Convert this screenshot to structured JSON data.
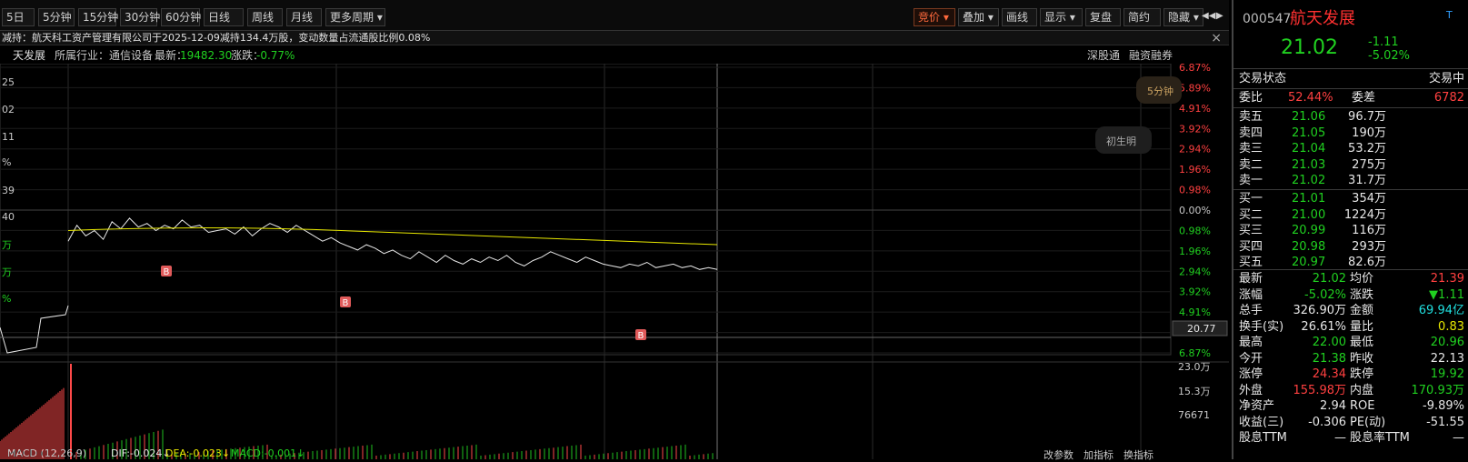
{
  "toolbar": {
    "left_buttons": [
      "5日",
      "5分钟",
      "15分钟",
      "30分钟",
      "60分钟",
      "日线",
      "周线",
      "月线",
      "更多周期"
    ],
    "right_buttons": [
      "竞价",
      "叠加",
      "画线",
      "显示",
      "复盘",
      "简约",
      "隐藏"
    ],
    "nav_icons": [
      "◀◀",
      "▶"
    ]
  },
  "notice": {
    "text": "减持：航天科工资产管理有限公司于2025-12-09减持134.4万股，变动数量占流通股比例0.08%",
    "close": "×"
  },
  "infobar": {
    "name": "天发展",
    "industry": "所属行业：通信设备",
    "latest": "最新：",
    "latest_value": "19482.30",
    "change": "涨跌：",
    "change_value": "-0.77%",
    "link1": "深股通",
    "link2": "融资融券"
  },
  "chart": {
    "right_axis_labels": [
      "6.87%",
      "5.89%",
      "4.91%",
      "3.92%",
      "2.94%",
      "1.96%",
      "0.98%",
      "0.00%",
      "0.98%",
      "1.96%",
      "2.94%",
      "3.92%",
      "4.91%",
      "5.89%",
      "6.87%"
    ],
    "left_axis_labels": [
      "25",
      "02",
      "11",
      "%",
      "39",
      "40",
      "万",
      "万",
      "%"
    ],
    "current_price_label": "20.77",
    "period_badge": "5分钟",
    "help_badge": "初生明",
    "b_label": "B",
    "volume_axis_labels": [
      "23.0万",
      "15.3万",
      "76671"
    ],
    "macd_label": "MACD (12,26,9)",
    "dif": "DIF:-0.024↓",
    "dea": "DEA:-0.023↓",
    "macd_value": "MACD:-0.001↓",
    "bottom_links": [
      "改参数",
      "加指标",
      "换指标"
    ]
  },
  "panel": {
    "code": "000547",
    "name": "航天发展",
    "badge": "T",
    "price": "21.02",
    "change": "-1.11",
    "change_pct": "-5.02%",
    "status_label": "交易状态",
    "status_value": "交易中",
    "ratio_label": "委比",
    "ratio_value": "52.44%",
    "diff_label": "委差",
    "diff_value": "6782",
    "sells": [
      {
        "label": "卖五",
        "price": "21.06",
        "vol": "96.7万"
      },
      {
        "label": "卖四",
        "price": "21.05",
        "vol": "190万"
      },
      {
        "label": "卖三",
        "price": "21.04",
        "vol": "53.2万"
      },
      {
        "label": "卖二",
        "price": "21.03",
        "vol": "275万"
      },
      {
        "label": "卖一",
        "price": "21.02",
        "vol": "31.7万"
      }
    ],
    "buys": [
      {
        "label": "买一",
        "price": "21.01",
        "vol": "354万"
      },
      {
        "label": "买二",
        "price": "21.00",
        "vol": "1224万"
      },
      {
        "label": "买三",
        "price": "20.99",
        "vol": "116万"
      },
      {
        "label": "买四",
        "price": "20.98",
        "vol": "293万"
      },
      {
        "label": "买五",
        "price": "20.97",
        "vol": "82.6万"
      }
    ],
    "stats": [
      {
        "l1": "最新",
        "v1": "21.02",
        "c1": "green",
        "l2": "均价",
        "v2": "21.39",
        "c2": "red"
      },
      {
        "l1": "涨幅",
        "v1": "-5.02%",
        "c1": "green",
        "l2": "涨跌",
        "v2": "▼1.11",
        "c2": "green"
      },
      {
        "l1": "总手",
        "v1": "326.90万",
        "c1": "white",
        "l2": "金额",
        "v2": "69.94亿",
        "c2": "cyan"
      },
      {
        "l1": "换手(实)",
        "v1": "26.61%",
        "c1": "white",
        "l2": "量比",
        "v2": "0.83",
        "c2": "yellow"
      },
      {
        "l1": "最高",
        "v1": "22.00",
        "c1": "green",
        "l2": "最低",
        "v2": "20.96",
        "c2": "green"
      },
      {
        "l1": "今开",
        "v1": "21.38",
        "c1": "green",
        "l2": "昨收",
        "v2": "22.13",
        "c2": "white"
      },
      {
        "l1": "涨停",
        "v1": "24.34",
        "c1": "red",
        "l2": "跌停",
        "v2": "19.92",
        "c2": "green"
      },
      {
        "l1": "外盘",
        "v1": "155.98万",
        "c1": "red",
        "l2": "内盘",
        "v2": "170.93万",
        "c2": "green"
      },
      {
        "l1": "净资产",
        "v1": "2.94",
        "c1": "white",
        "l2": "ROE",
        "v2": "-9.89%",
        "c2": "white"
      },
      {
        "l1": "收益(三)",
        "v1": "-0.306",
        "c1": "white",
        "l2": "PE(动)",
        "v2": "-51.55",
        "c2": "white"
      },
      {
        "l1": "股息TTM",
        "v1": "—",
        "c1": "white",
        "l2": "股息率TTM",
        "v2": "—",
        "c2": "white"
      }
    ]
  },
  "chart_data": {
    "type": "line",
    "title": "",
    "price_series": [
      0.3,
      1.2,
      0.6,
      0.9,
      0.4,
      1.4,
      1.0,
      1.6,
      1.1,
      1.3,
      0.9,
      1.2,
      1.0,
      1.5,
      1.1,
      1.2,
      0.8,
      0.9,
      1.0,
      0.7,
      1.1,
      0.6,
      1.0,
      1.3,
      1.1,
      0.8,
      1.2,
      0.9,
      0.6,
      0.3,
      0.5,
      0.2,
      0.0,
      -0.2,
      0.1,
      -0.1,
      -0.4,
      -0.2,
      -0.5,
      -0.7,
      -0.3,
      -0.6,
      -0.9,
      -0.5,
      -0.8,
      -1.0,
      -0.7,
      -0.9,
      -0.6,
      -0.8,
      -0.5,
      -0.9,
      -1.1,
      -0.8,
      -0.6,
      -0.3,
      -0.5,
      -0.7,
      -0.9,
      -0.6,
      -0.8,
      -1.0,
      -1.1,
      -1.2,
      -1.0,
      -1.1,
      -0.9,
      -1.2,
      -1.1,
      -1.0,
      -1.2,
      -1.1,
      -1.3,
      -1.2,
      -1.3
    ],
    "avg_series_start": 0.9,
    "avg_series_end": 0.1,
    "ylim": [
      -6.87,
      6.87
    ]
  }
}
